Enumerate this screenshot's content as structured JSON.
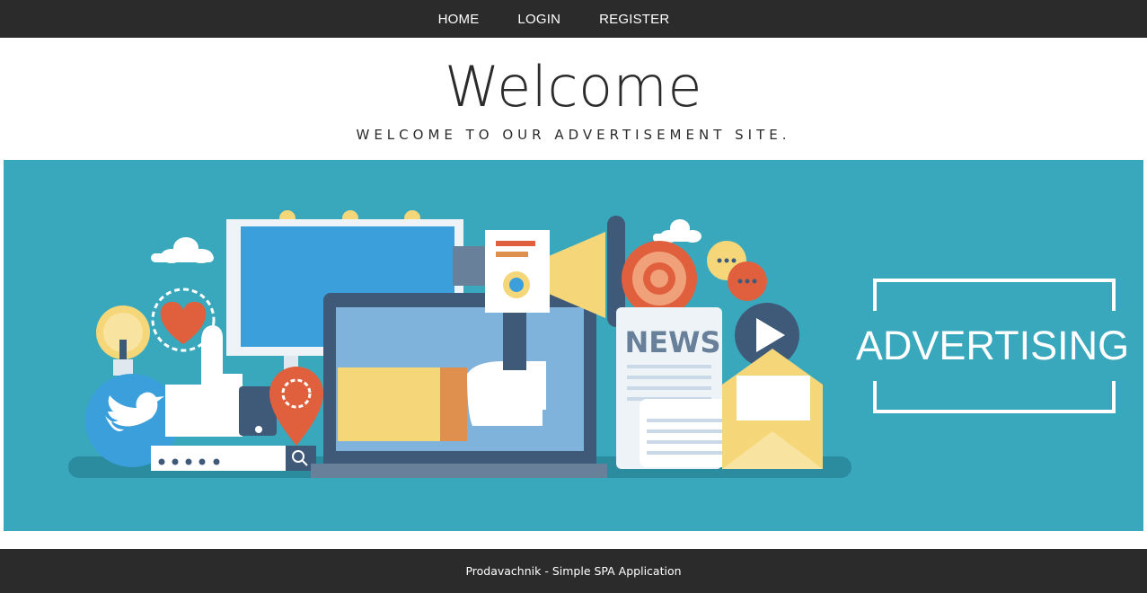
{
  "nav": {
    "items": [
      {
        "label": "HOME"
      },
      {
        "label": "LOGIN"
      },
      {
        "label": "REGISTER"
      }
    ]
  },
  "hero": {
    "title": "Welcome",
    "subtitle": "WELCOME TO OUR ADVERTISEMENT SITE."
  },
  "banner": {
    "news_label": "NEWS",
    "advertising_label": "ADVERTISING",
    "colors": {
      "background": "#3aa8bc",
      "accent_red": "#e0603e",
      "accent_yellow": "#f5d77a",
      "accent_blue": "#3a9fdb",
      "dark_slate": "#3f5a78"
    },
    "icons": [
      "cloud-icon",
      "lightbulb-icon",
      "heart-icon",
      "twitter-bird-icon",
      "thumbs-up-icon",
      "billboard-icon",
      "laptop-icon",
      "megaphone-icon",
      "gear-icon",
      "chat-bubble-icon",
      "play-icon",
      "newspaper-icon",
      "envelope-icon",
      "location-pin-icon",
      "search-icon",
      "password-field-icon"
    ]
  },
  "footer": {
    "text": "Prodavachnik - Simple SPA Application"
  }
}
